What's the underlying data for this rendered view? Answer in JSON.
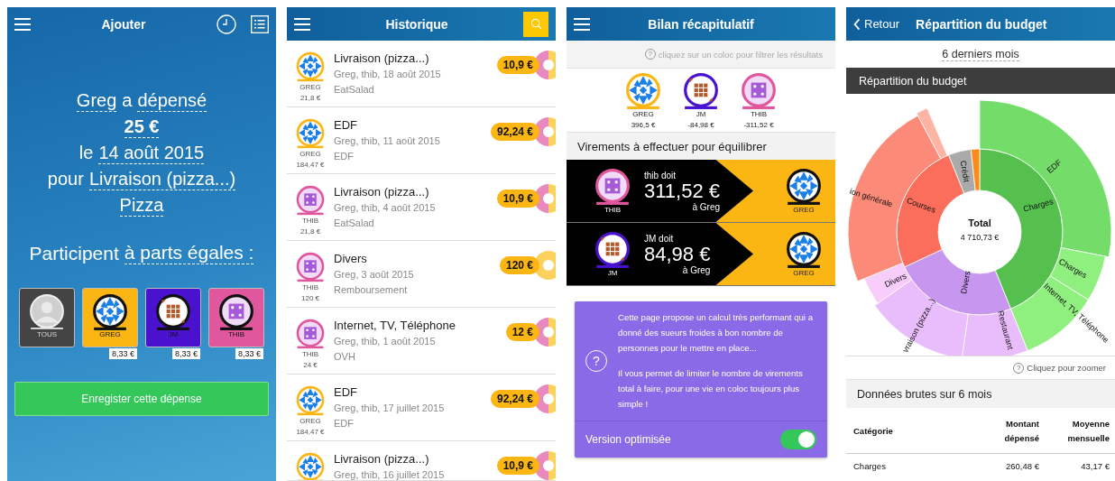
{
  "add_screen": {
    "header": {
      "title": "Ajouter"
    },
    "sentence": [
      [
        {
          "text": "Greg",
          "editable": true,
          "bold": false
        },
        {
          "text": "a",
          "editable": false,
          "bold": false
        },
        {
          "text": "dépensé",
          "editable": true,
          "bold": false
        }
      ],
      [
        {
          "text": "25 €",
          "editable": true,
          "bold": true
        }
      ],
      [
        {
          "text": "le",
          "editable": false,
          "bold": false
        },
        {
          "text": "14 août 2015",
          "editable": true,
          "bold": false
        }
      ],
      [
        {
          "text": "pour",
          "editable": false,
          "bold": false
        },
        {
          "text": "Livraison (pizza...)",
          "editable": true,
          "bold": false
        }
      ],
      [
        {
          "text": "Pizza",
          "editable": true,
          "bold": false
        }
      ]
    ],
    "split_line": [
      {
        "text": "Participent",
        "editable": false
      },
      {
        "text": "à parts égales :",
        "editable": true
      }
    ],
    "participants": [
      {
        "name": "TOUS",
        "kind": "silhouette",
        "color": "#444444"
      },
      {
        "name": "GREG",
        "kind": "star",
        "color": "#fbb614",
        "share": "8,33 €"
      },
      {
        "name": "JM",
        "kind": "tile",
        "color": "#4a12cf",
        "share": "8,33 €"
      },
      {
        "name": "THIB",
        "kind": "dice",
        "color": "#e0579d",
        "share": "8,33 €"
      }
    ],
    "save_button": "Enregister cette dépense"
  },
  "history_screen": {
    "header": {
      "title": "Historique"
    },
    "expenses": [
      {
        "payer": "GREG",
        "kind": "star",
        "color": "#fbb614",
        "payer_amount": "21,8 €",
        "title": "Livraison (pizza...)",
        "details": "Greg, thib, 18 août 2015",
        "category": "EatSalad",
        "share": "10,9 €",
        "split": [
          {
            "color": "#e88abd"
          },
          {
            "color": "#fdd15e"
          }
        ]
      },
      {
        "payer": "GREG",
        "kind": "star",
        "color": "#fbb614",
        "payer_amount": "184,47 €",
        "title": "EDF",
        "details": "Greg, thib, 11 août 2015",
        "category": "EDF",
        "share": "92,24 €",
        "split": [
          {
            "color": "#e88abd"
          },
          {
            "color": "#fdd15e"
          }
        ]
      },
      {
        "payer": "THIB",
        "kind": "dice",
        "color": "#e0579d",
        "payer_amount": "21,8 €",
        "title": "Livraison (pizza...)",
        "details": "Greg, thib, 4 août 2015",
        "category": "EatSalad",
        "share": "10,9 €",
        "split": [
          {
            "color": "#e88abd"
          },
          {
            "color": "#fdd15e"
          }
        ]
      },
      {
        "payer": "THIB",
        "kind": "dice",
        "color": "#e0579d",
        "payer_amount": "120 €",
        "title": "Divers",
        "details": "Greg, 3 août 2015",
        "category": "Remboursement",
        "share": "120 €",
        "split": [
          {
            "color": "#fdd15e"
          }
        ]
      },
      {
        "payer": "THIB",
        "kind": "dice",
        "color": "#e0579d",
        "payer_amount": "24 €",
        "title": "Internet, TV, Téléphone",
        "details": "Greg, thib, 1 août 2015",
        "category": "OVH",
        "share": "12 €",
        "split": [
          {
            "color": "#e88abd"
          },
          {
            "color": "#fdd15e"
          }
        ]
      },
      {
        "payer": "GREG",
        "kind": "star",
        "color": "#fbb614",
        "payer_amount": "184,47 €",
        "title": "EDF",
        "details": "Greg, thib, 17 juillet 2015",
        "category": "EDF",
        "share": "92,24 €",
        "split": [
          {
            "color": "#e88abd"
          },
          {
            "color": "#fdd15e"
          }
        ]
      },
      {
        "kind": "star",
        "color": "#fbb614",
        "title": "Livraison (pizza...)",
        "details": "Greg, thib, 16 juillet 2015",
        "share": "10,9 €",
        "split": [
          {
            "color": "#e88abd"
          },
          {
            "color": "#fdd15e"
          }
        ]
      }
    ]
  },
  "summary_screen": {
    "header": {
      "title": "Bilan récapitulatif"
    },
    "hint_icon": "?",
    "hint": "cliquez sur un coloc pour filtrer les résultats",
    "members": [
      {
        "name": "GREG",
        "kind": "star",
        "color": "#fbb614",
        "balance": "396,5 €"
      },
      {
        "name": "JM",
        "kind": "tile",
        "color": "#4a12cf",
        "balance": "-84,98 €"
      },
      {
        "name": "THIB",
        "kind": "dice",
        "color": "#e0579d",
        "balance": "-311,52 €"
      }
    ],
    "section_title": "Virements à effectuer pour équilibrer",
    "transfers": [
      {
        "from": {
          "name": "THIB",
          "kind": "dice",
          "color": "#e0579d"
        },
        "debtor_text": "thib doit",
        "amount": "311,52 €",
        "creditor_text": "à Greg",
        "to": {
          "name": "GREG",
          "kind": "star",
          "color": "#111111"
        }
      },
      {
        "from": {
          "name": "JM",
          "kind": "tile",
          "color": "#4a12cf"
        },
        "debtor_text": "JM doit",
        "amount": "84,98 €",
        "creditor_text": "à Greg",
        "to": {
          "name": "GREG",
          "kind": "star",
          "color": "#111111"
        }
      }
    ],
    "info": {
      "icon": "?",
      "paragraphs": [
        "Cette page propose un calcul très performant qui a donné des sueurs froides à bon nombre de personnes pour le mettre en place...",
        "Il vous permet de limiter le nombre de virements total à faire, pour une vie en coloc toujours plus simple !"
      ],
      "toggle_label": "Version optimisée",
      "toggle_on": true
    }
  },
  "budget_screen": {
    "header": {
      "back": "Retour",
      "title": "Répartition du budget"
    },
    "period": "6 derniers mois",
    "chart_title": "Répartition du budget",
    "sunburst": {
      "center_title": "Total",
      "center_value": "4 710,73 €",
      "labels": [
        "ion générale",
        "Courses",
        "Crédit",
        "EDF",
        "Charges",
        "Charges",
        "Internet, TV, Téléphone",
        "Divers",
        "Divers",
        "vraison (pizza...)",
        "Restaurant"
      ]
    },
    "hint_icon": "?",
    "hint": "Cliquez pour zoomer",
    "table_title": "Données brutes sur 6 mois",
    "table": {
      "columns": [
        "Catégorie",
        "Montant dépensé",
        "Moyenne mensuelle"
      ],
      "rows": [
        [
          "Charges",
          "260,48 €",
          "43,17 €"
        ]
      ]
    }
  }
}
